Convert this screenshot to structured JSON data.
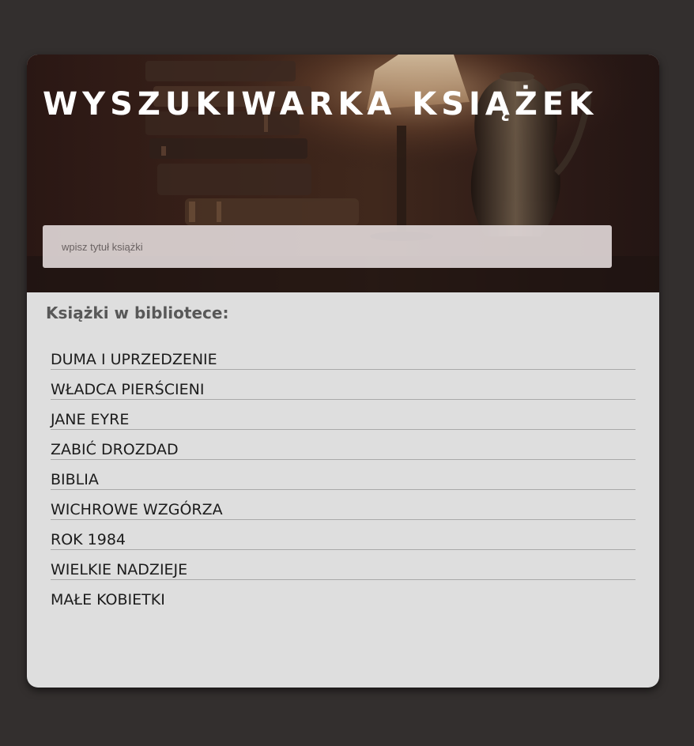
{
  "header": {
    "title": "WYSZUKIWARKA KSIĄŻEK"
  },
  "search": {
    "placeholder": "wpisz tytuł książki",
    "value": ""
  },
  "library": {
    "heading": "Książki w bibliotece:",
    "books": [
      "DUMA I UPRZEDZENIE",
      "WŁADCA PIERŚCIENI",
      "JANE EYRE",
      "ZABIĆ DROZDAD",
      "BIBLIA",
      "WICHROWE WZGÓRZA",
      "ROK 1984",
      "WIELKIE NADZIEJE",
      "MAŁE KOBIETKI"
    ]
  },
  "colors": {
    "page_background": "#332f2e",
    "card_background": "#dedede",
    "hero_tint": "#3a2219",
    "title_text": "#ffffff",
    "heading_text": "#585858",
    "book_text": "#1c1c1c"
  }
}
